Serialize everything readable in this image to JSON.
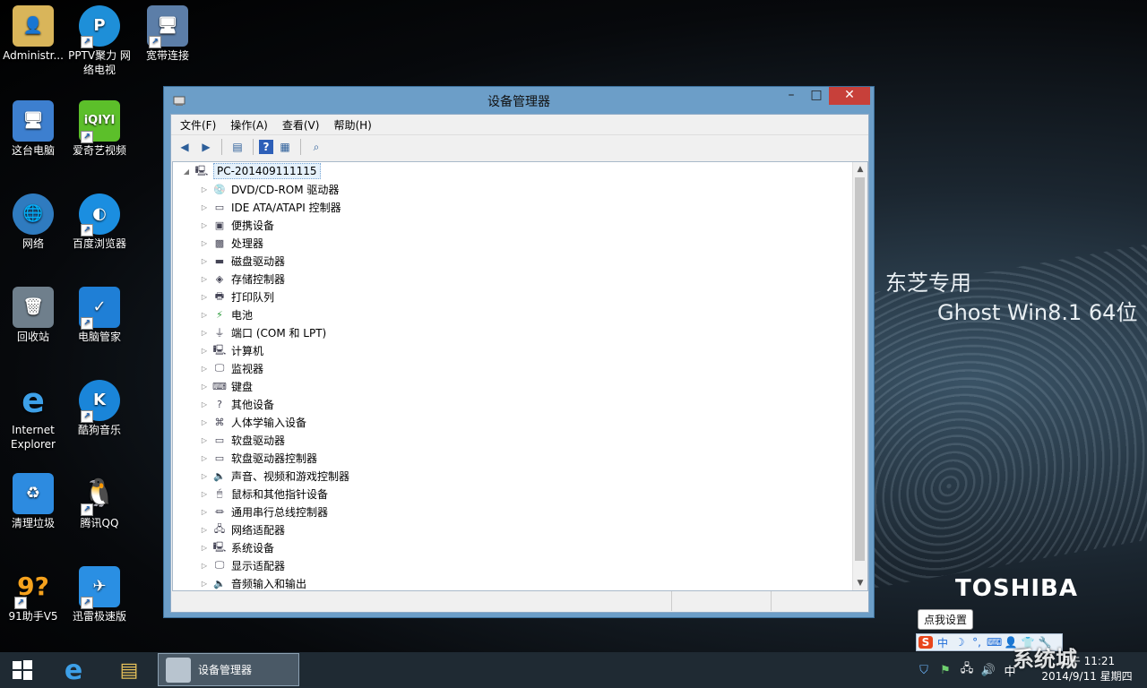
{
  "desktop": {
    "icons": [
      {
        "label": "Administr..."
      },
      {
        "label": "PPTV聚力 网络电视"
      },
      {
        "label": "宽带连接"
      },
      {
        "label": "这台电脑"
      },
      {
        "label": "爱奇艺视频"
      },
      {
        "label": "网络"
      },
      {
        "label": "百度浏览器"
      },
      {
        "label": "回收站"
      },
      {
        "label": "电脑管家"
      },
      {
        "label": "Internet Explorer"
      },
      {
        "label": "酷狗音乐"
      },
      {
        "label": "清理垃圾"
      },
      {
        "label": "腾讯QQ"
      },
      {
        "label": "91助手V5"
      },
      {
        "label": "迅雷极速版"
      }
    ],
    "brand_line1": "东芝专用",
    "brand_line2": "Ghost Win8.1 64位",
    "brand_logo": "TOSHIBA"
  },
  "window": {
    "title": "设备管理器",
    "menu": [
      "文件(F)",
      "操作(A)",
      "查看(V)",
      "帮助(H)"
    ],
    "tree": {
      "root": "PC-201409111115",
      "items": [
        "DVD/CD-ROM 驱动器",
        "IDE ATA/ATAPI 控制器",
        "便携设备",
        "处理器",
        "磁盘驱动器",
        "存储控制器",
        "打印队列",
        "电池",
        "端口 (COM 和 LPT)",
        "计算机",
        "监视器",
        "键盘",
        "其他设备",
        "人体学输入设备",
        "软盘驱动器",
        "软盘驱动器控制器",
        "声音、视频和游戏控制器",
        "鼠标和其他指针设备",
        "通用串行总线控制器",
        "网络适配器",
        "系统设备",
        "显示适配器",
        "音频输入和输出"
      ]
    }
  },
  "ime": {
    "tooltip": "点我设置",
    "mode": "中"
  },
  "taskbar": {
    "active_task": "设备管理器",
    "clock_time": "上午 11:21",
    "clock_date": "2014/9/11 星期四",
    "watermark": "系统城"
  },
  "colors": {
    "close_button": "#c7403a",
    "window_frame": "#6c9ec8",
    "taskbar": "#1f2a33"
  }
}
